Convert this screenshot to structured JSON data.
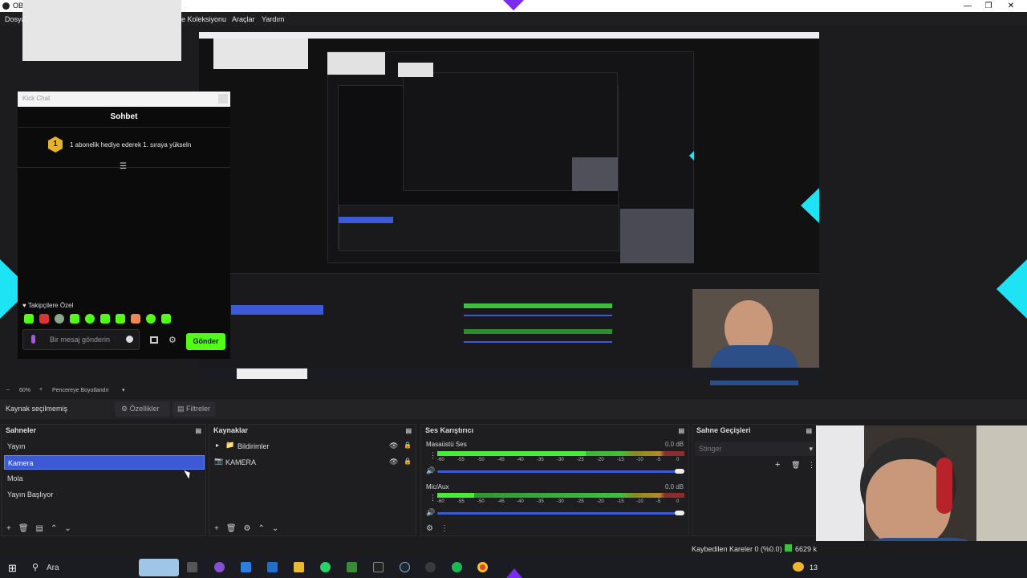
{
  "window": {
    "title": "OBS"
  },
  "menu": {
    "file": "Dosya",
    "collection": "e Koleksiyonu",
    "tools": "Araçlar",
    "help": "Yardım"
  },
  "chat": {
    "window_title": "Kick Chat",
    "title": "Sohbet",
    "pinned": "1 abonelik hediye ederek 1. sıraya yükseln",
    "rank_badge": "1",
    "emote_label": "Takipçilere Özel",
    "input_placeholder": "Bir mesaj gönderin",
    "send": "Gönder"
  },
  "zoom": {
    "level": "60%",
    "mode": "Pencereye Boyutlandır"
  },
  "props": {
    "no_source": "Kaynak seçilmemiş",
    "properties": "Özellikler",
    "filters": "Filtreler"
  },
  "scenes": {
    "title": "Sahneler",
    "items": [
      "Yayın",
      "Kamera",
      "Mola",
      "Yayın Başlıyor"
    ],
    "selected": "Kamera"
  },
  "sources": {
    "title": "Kaynaklar",
    "items": [
      "Bildirimler",
      "KAMERA"
    ]
  },
  "mixer": {
    "title": "Ses Karıştırıcı",
    "channels": [
      {
        "name": "Masaüstü Ses",
        "db": "0.0 dB",
        "level": 0.6
      },
      {
        "name": "Mic/Aux",
        "db": "0.0 dB",
        "level": 0.15
      }
    ],
    "ticks": [
      "-60",
      "-55",
      "-50",
      "-45",
      "-40",
      "-35",
      "-30",
      "-25",
      "-20",
      "-15",
      "-10",
      "-5",
      "0"
    ]
  },
  "transitions": {
    "title": "Sahne Geçişleri",
    "selected": "Stinger"
  },
  "status": {
    "dropped": "Kaybedilen Kareler 0 (%0.0)",
    "bitrate": "6629 k"
  },
  "taskbar": {
    "search": "Ara",
    "time": "13"
  },
  "colors": {
    "accent": "#3d5ad6",
    "kick_green": "#53fc18",
    "cyan": "#1ee3f5"
  }
}
